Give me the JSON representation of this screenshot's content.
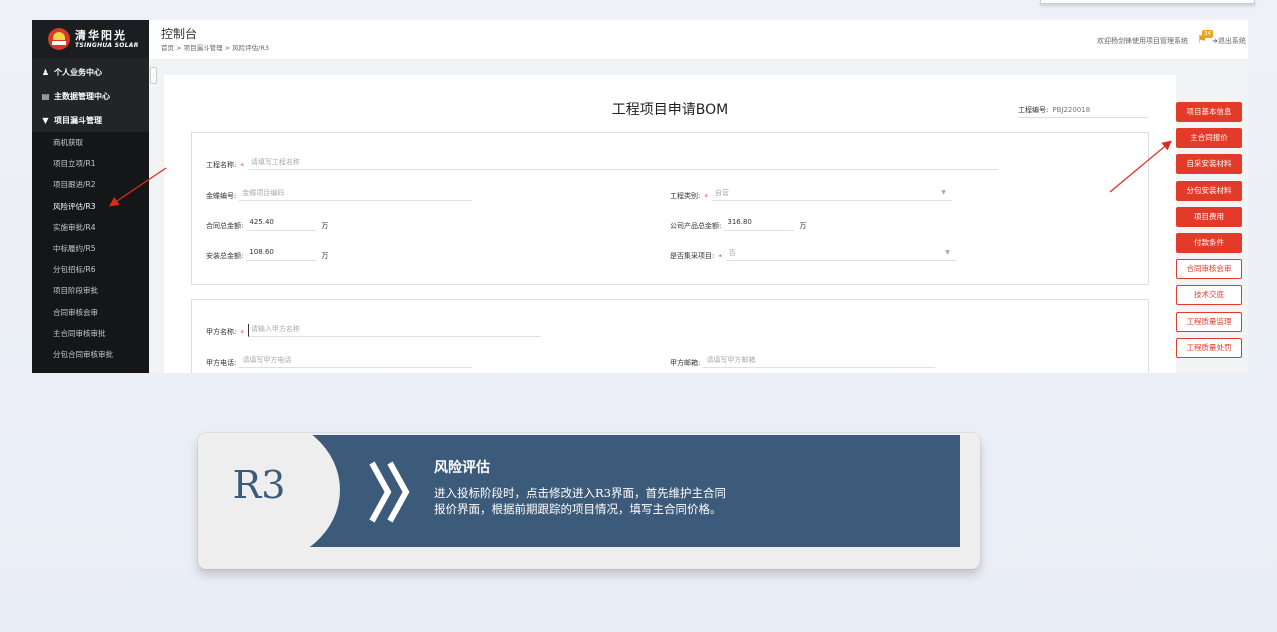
{
  "sidebar": {
    "logo_cn": "清华阳光",
    "logo_en": "TSINGHUA SOLAR",
    "top_items": [
      {
        "label": "个人业务中心",
        "icon": "user-icon"
      },
      {
        "label": "主数据管理中心",
        "icon": "database-icon"
      },
      {
        "label": "项目漏斗管理",
        "icon": "caret-down-icon"
      }
    ],
    "sub_items": [
      "商机获取",
      "项目立项/R1",
      "项目跟进/R2",
      "风险评估/R3",
      "实施审批/R4",
      "中标履约/R5",
      "分包招标/R6",
      "项目阶段审批",
      "合同审核会审",
      "主合同审核审批",
      "分包合同审核审批"
    ]
  },
  "header": {
    "title": "控制台",
    "breadcrumb": "首页 > 项目漏斗管理 > 风险评估/R3",
    "welcome": "欢迎杨剑锋使用项目管理系统",
    "badge": "34",
    "logout": "退出系统"
  },
  "form": {
    "title": "工程项目申请BOM",
    "project_no_label": "工程编号:",
    "project_no": "PBJ220018",
    "req": "*",
    "project_name": {
      "label": "工程名称:",
      "placeholder": "请填写工程名称"
    },
    "gold_no": {
      "label": "金蝶编号:",
      "placeholder": "金蝶项目编码"
    },
    "project_type": {
      "label": "工程类别:",
      "value": "自营"
    },
    "contract_total": {
      "label": "合同总金额:",
      "value": "425.40",
      "unit": "万"
    },
    "product_total": {
      "label": "公司产品总金额:",
      "value": "316.80",
      "unit": "万"
    },
    "install_total": {
      "label": "安装总金额:",
      "value": "108.60",
      "unit": "万"
    },
    "collective": {
      "label": "是否集采项目:",
      "value": "否"
    },
    "party_a_name": {
      "label": "甲方名称:",
      "placeholder": "请输入甲方名称"
    },
    "party_a_phone": {
      "label": "甲方电话:",
      "placeholder": "请填写甲方电话"
    },
    "party_a_email": {
      "label": "甲方邮箱:",
      "placeholder": "请填写甲方邮箱"
    }
  },
  "right_buttons": [
    {
      "label": "项目基本信息",
      "style": "solid"
    },
    {
      "label": "主合同报价",
      "style": "solid"
    },
    {
      "label": "自采安装材料",
      "style": "solid"
    },
    {
      "label": "分包安装材料",
      "style": "solid"
    },
    {
      "label": "项目费用",
      "style": "solid"
    },
    {
      "label": "付款条件",
      "style": "solid"
    },
    {
      "label": "合同审核会审",
      "style": "outline"
    },
    {
      "label": "技术交底",
      "style": "outline"
    },
    {
      "label": "工程质量监理",
      "style": "outline"
    },
    {
      "label": "工程质量处罚",
      "style": "outline"
    }
  ],
  "callout": {
    "code": "R3",
    "title": "风险评估",
    "line1": "进入投标阶段时，点击修改进入R3界面，首先维护主合同",
    "line2": "报价界面，根据前期跟踪的项目情况，填写主合同价格。"
  },
  "colors": {
    "accent_red": "#e23b2a",
    "band_blue": "#3c5a7a",
    "sidebar": "#222428"
  }
}
